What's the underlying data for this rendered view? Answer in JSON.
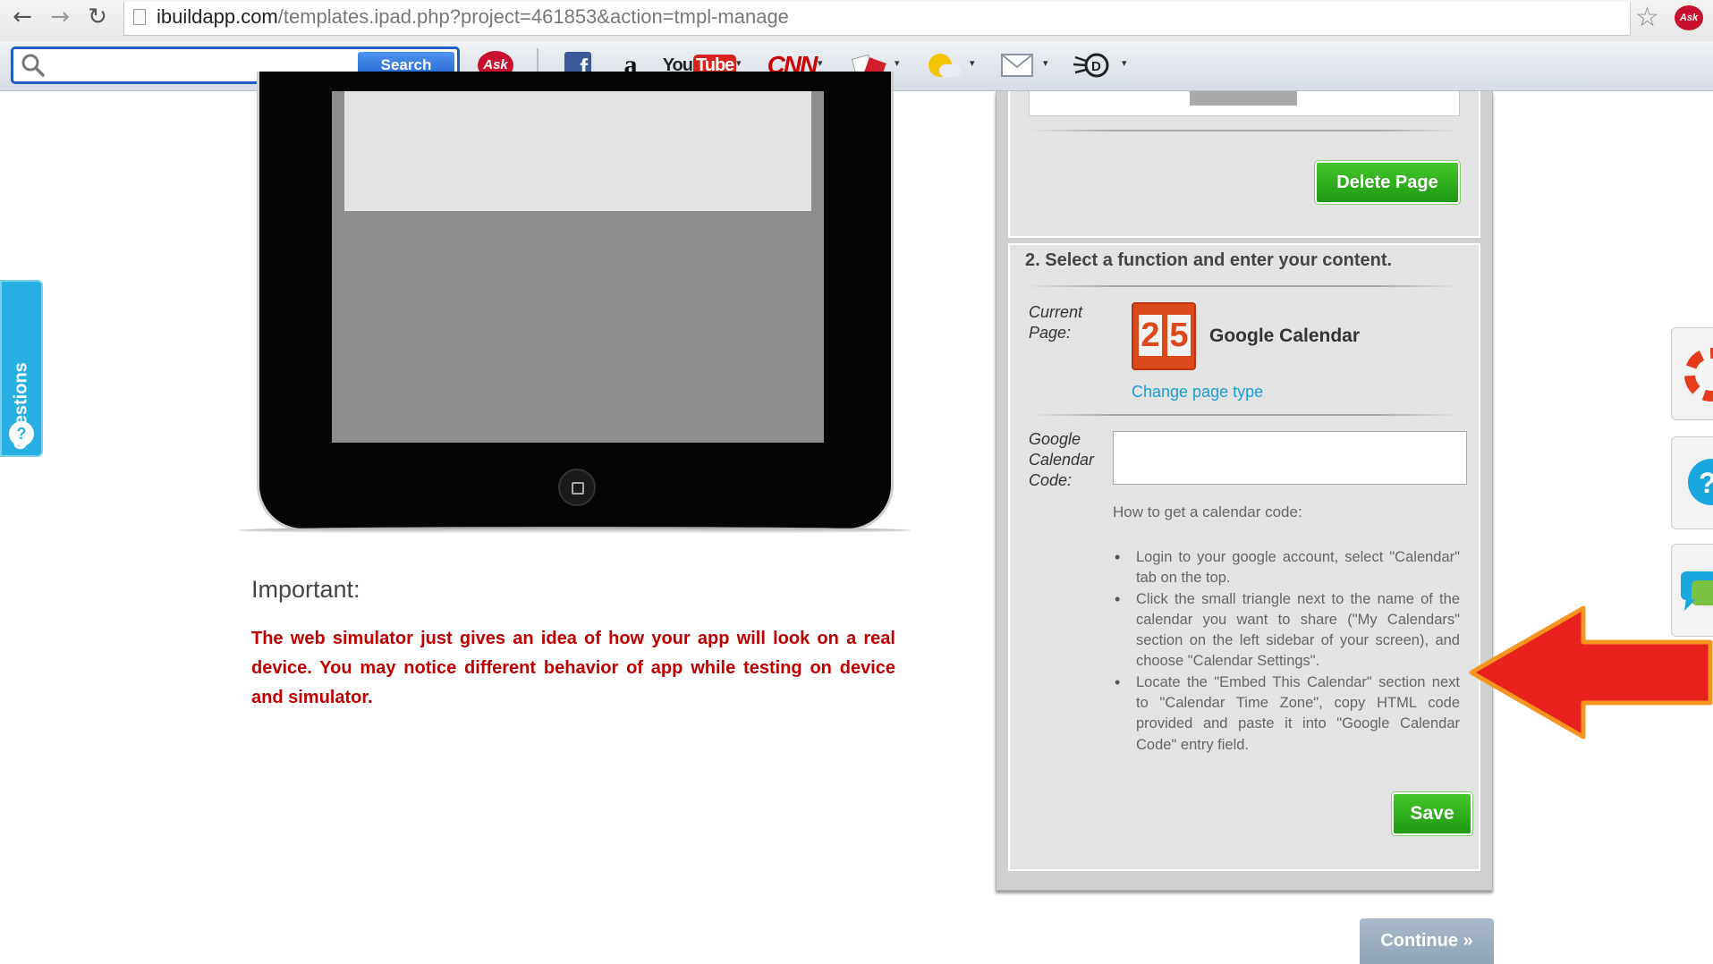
{
  "browser": {
    "url_domain": "ibuildapp.com",
    "url_path": "/templates.ipad.php?project=461853&action=tmpl-manage"
  },
  "toolbar": {
    "search_button": "Search",
    "search_placeholder": "",
    "ask_label": "Ask",
    "items": [
      "facebook",
      "amazon",
      "youtube",
      "cnn",
      "games",
      "weather",
      "mail",
      "dictionary"
    ]
  },
  "sidebar_tab": {
    "label": "Questions",
    "icon_glyph": "?"
  },
  "left": {
    "important_title": "Important:",
    "important_text": "The web simulator just gives an idea of how your app will look on a real device. You may notice different behavior of app while testing on device and simulator."
  },
  "panel": {
    "delete_button": "Delete Page",
    "section_title": "2. Select a function and enter your content.",
    "current_page_label_1": "Current",
    "current_page_label_2": "Page:",
    "calendar_digit_1": "2",
    "calendar_digit_2": "5",
    "page_type": "Google Calendar",
    "change_link": "Change page type",
    "code_label_1": "Google",
    "code_label_2": "Calendar",
    "code_label_3": "Code:",
    "code_value": "",
    "how_to": "How to get a calendar code:",
    "instructions": [
      "Login to your google account, select \"Calendar\" tab on the top.",
      "Click the small triangle next to the name of the calendar you want to share (\"My Calendars\" section on the left sidebar of your screen), and choose \"Calendar Settings\".",
      "Locate the \"Embed This Calendar\" section next to \"Calendar Time Zone\", copy HTML code provided and paste it into \"Google Calendar Code\" entry field."
    ],
    "save_button": "Save"
  },
  "continue_button": "Continue »",
  "colors": {
    "accent_green": "#2fae1c",
    "link_blue": "#1a9fd5",
    "warning_red": "#c00000",
    "arrow_red": "#e8201e",
    "arrow_outline": "#f7941d"
  }
}
